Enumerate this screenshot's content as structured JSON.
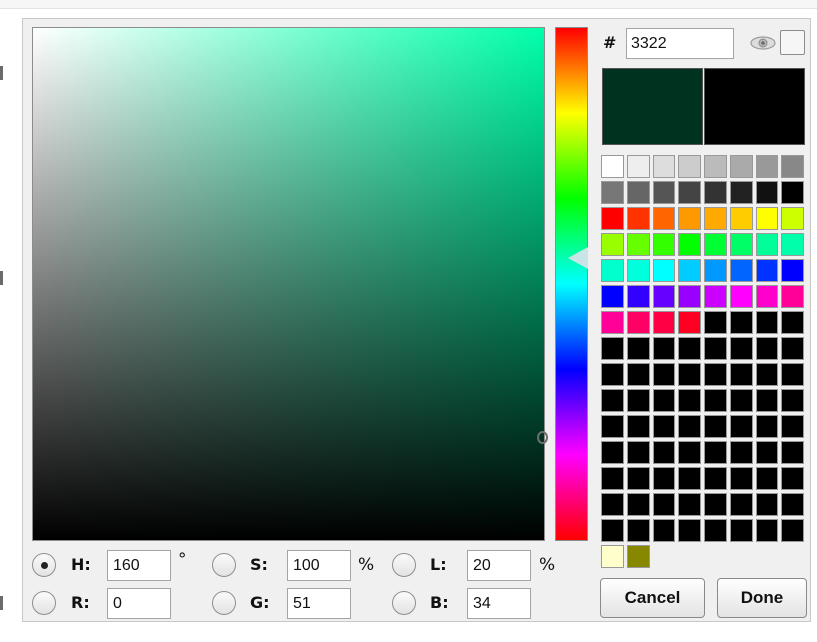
{
  "hex": {
    "symbol": "#",
    "value": "3322"
  },
  "preview": {
    "new_color": "#00331f",
    "old_color": "#000000"
  },
  "palette_rows": [
    [
      "#ffffff",
      "#eeeeee",
      "#dddddd",
      "#cccccc",
      "#bbbbbb",
      "#aaaaaa",
      "#999999",
      "#888888"
    ],
    [
      "#777777",
      "#666666",
      "#555555",
      "#444444",
      "#333333",
      "#222222",
      "#111111",
      "#000000"
    ],
    [
      "#ff0000",
      "#ff3300",
      "#ff6600",
      "#ff9900",
      "#ffaa00",
      "#ffcc00",
      "#ffff00",
      "#ccff00"
    ],
    [
      "#99ff00",
      "#66ff00",
      "#33ff00",
      "#00ff00",
      "#00ff33",
      "#00ff66",
      "#00ff99",
      "#00ffaa"
    ],
    [
      "#00ffcc",
      "#00ffdd",
      "#00ffff",
      "#00ccff",
      "#0099ff",
      "#0066ff",
      "#0033ff",
      "#0000ff"
    ],
    [
      "#0000ff",
      "#3300ff",
      "#6600ff",
      "#9900ff",
      "#cc00ff",
      "#ff00ff",
      "#ff00cc",
      "#ff0099"
    ],
    [
      "#ff0099",
      "#ff0066",
      "#ff0044",
      "#ff0022",
      "#000000",
      "#000000",
      "#000000",
      "#000000"
    ],
    [
      "#000000",
      "#000000",
      "#000000",
      "#000000",
      "#000000",
      "#000000",
      "#000000",
      "#000000"
    ],
    [
      "#000000",
      "#000000",
      "#000000",
      "#000000",
      "#000000",
      "#000000",
      "#000000",
      "#000000"
    ],
    [
      "#000000",
      "#000000",
      "#000000",
      "#000000",
      "#000000",
      "#000000",
      "#000000",
      "#000000"
    ],
    [
      "#000000",
      "#000000",
      "#000000",
      "#000000",
      "#000000",
      "#000000",
      "#000000",
      "#000000"
    ],
    [
      "#000000",
      "#000000",
      "#000000",
      "#000000",
      "#000000",
      "#000000",
      "#000000",
      "#000000"
    ],
    [
      "#000000",
      "#000000",
      "#000000",
      "#000000",
      "#000000",
      "#000000",
      "#000000",
      "#000000"
    ],
    [
      "#000000",
      "#000000",
      "#000000",
      "#000000",
      "#000000",
      "#000000",
      "#000000",
      "#000000"
    ],
    [
      "#000000",
      "#000000",
      "#000000",
      "#000000",
      "#000000",
      "#000000",
      "#000000",
      "#000000"
    ]
  ],
  "extra_swatches": [
    "#ffffcc",
    "#888800"
  ],
  "fields": {
    "h": {
      "label": "H:",
      "value": "160",
      "unit": "°",
      "selected": true
    },
    "s": {
      "label": "S:",
      "value": "100",
      "unit": "%"
    },
    "l": {
      "label": "L:",
      "value": "20",
      "unit": "%"
    },
    "r": {
      "label": "R:",
      "value": "0"
    },
    "g": {
      "label": "G:",
      "value": "51"
    },
    "b": {
      "label": "B:",
      "value": "34"
    }
  },
  "buttons": {
    "cancel": "Cancel",
    "done": "Done"
  },
  "icons": {
    "eye": "eye-icon"
  }
}
